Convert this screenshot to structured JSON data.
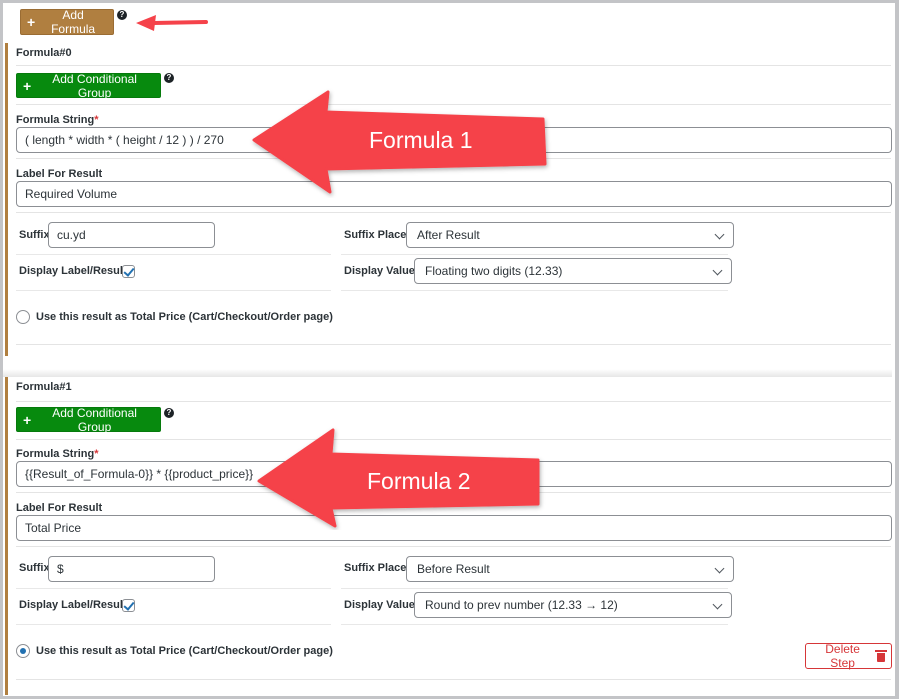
{
  "toolbar": {
    "add_formula_label": "Add Formula",
    "help_icon": "question-circle-icon"
  },
  "formulas": [
    {
      "title": "Formula#0",
      "add_conditional_group_label": "Add Conditional Group",
      "formula_string_label": "Formula String",
      "required_mark": "*",
      "formula_string_value": "( length * width * ( height / 12 ) ) / 270",
      "label_for_result_label": "Label For Result",
      "label_for_result_value": "Required Volume",
      "suffix_label": "Suffix",
      "suffix_value": "cu.yd",
      "suffix_place_label": "Suffix Place",
      "suffix_place_value": "After Result",
      "display_label_result_label": "Display Label/Result",
      "display_label_result_checked": true,
      "display_value_label": "Display Value",
      "display_value_value": "Floating two digits (12.33)",
      "total_price_label": "Use this result as Total Price (Cart/Checkout/Order page)",
      "total_price_selected": false
    },
    {
      "title": "Formula#1",
      "add_conditional_group_label": "Add Conditional Group",
      "formula_string_label": "Formula String",
      "required_mark": "*",
      "formula_string_value": "{{Result_of_Formula-0}} * {{product_price}}",
      "label_for_result_label": "Label For Result",
      "label_for_result_value": "Total Price",
      "suffix_label": "Suffix",
      "suffix_value": "$",
      "suffix_place_label": "Suffix Place",
      "suffix_place_value": "Before Result",
      "display_label_result_label": "Display Label/Result",
      "display_label_result_checked": true,
      "display_value_label": "Display Value",
      "display_value_value": "Round to prev number (12.33 → 12)",
      "total_price_label": "Use this result as Total Price (Cart/Checkout/Order page)",
      "total_price_selected": true,
      "delete_step_label": "Delete Step"
    }
  ],
  "annotations": [
    {
      "label": "Formula 1",
      "color": "#f5424a"
    },
    {
      "label": "Formula 2",
      "color": "#f5424a"
    }
  ],
  "colors": {
    "add_formula_bg": "#b07f40",
    "conditional_group_bg": "#078a0e",
    "delete_red": "#d63638",
    "annotation_red": "#f5424a"
  }
}
